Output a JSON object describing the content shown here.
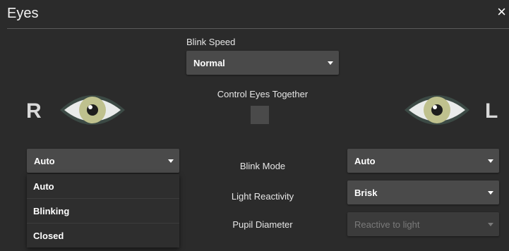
{
  "window": {
    "title": "Eyes",
    "close_label": "×"
  },
  "blink_speed": {
    "label": "Blink Speed",
    "value": "Normal"
  },
  "control_together": {
    "label": "Control Eyes Together",
    "checked": false
  },
  "right_eye": {
    "letter": "R",
    "blink_mode_value": "Auto",
    "dropdown_options": [
      "Auto",
      "Blinking",
      "Closed"
    ]
  },
  "left_eye": {
    "letter": "L",
    "blink_mode_value": "Auto",
    "light_reactivity_value": "Brisk",
    "pupil_diameter_value": "Reactive to light"
  },
  "rows": {
    "blink_mode": "Blink Mode",
    "light_reactivity": "Light Reactivity",
    "pupil_diameter": "Pupil Diameter"
  },
  "colors": {
    "background": "#2b2b2b",
    "control": "#4a4a4a",
    "eye_white": "#e9ebea",
    "eye_iris": "#bfc18e",
    "eye_outline": "#3c4a45"
  },
  "icons": {
    "right": "eye-icon",
    "left": "eye-icon",
    "close": "close-icon"
  }
}
